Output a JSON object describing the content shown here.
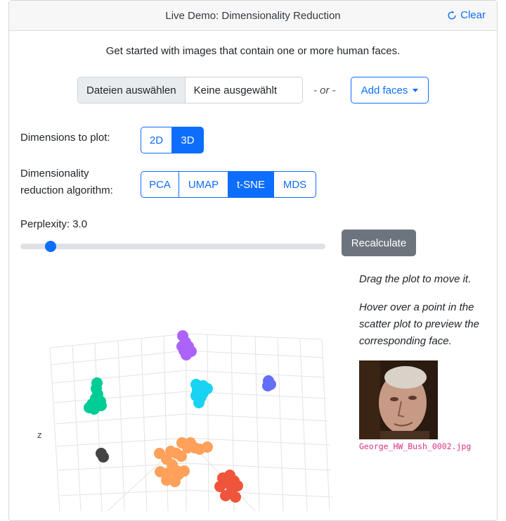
{
  "header": {
    "title": "Live Demo: Dimensionality Reduction",
    "clear_label": "Clear"
  },
  "intro": "Get started with images that contain one or more human faces.",
  "file_input": {
    "button_label": "Dateien auswählen",
    "status": "Keine ausgewählt"
  },
  "or_text": "- or -",
  "add_faces_label": "Add faces",
  "dimensions": {
    "label": "Dimensions to plot:",
    "options": [
      "2D",
      "3D"
    ],
    "selected": "3D"
  },
  "algorithm": {
    "label_line1": "Dimensionality",
    "label_line2": "reduction algorithm:",
    "options": [
      "PCA",
      "UMAP",
      "t-SNE",
      "MDS"
    ],
    "selected": "t-SNE"
  },
  "perplexity": {
    "label": "Perplexity: 3.0",
    "value": 3.0,
    "fraction": 0.1
  },
  "recalculate_label": "Recalculate",
  "hints": {
    "drag": "Drag the plot to move it.",
    "hover": "Hover over a point in the scatter plot to preview the corresponding face."
  },
  "preview": {
    "filename": "George_HW_Bush_0002.jpg"
  },
  "plot": {
    "z_axis_label": "z",
    "cluster_colors": [
      "#ab63fa",
      "#00cc96",
      "#19d3f3",
      "#636efa",
      "#444444",
      "#ffa15a",
      "#ef553b"
    ]
  }
}
